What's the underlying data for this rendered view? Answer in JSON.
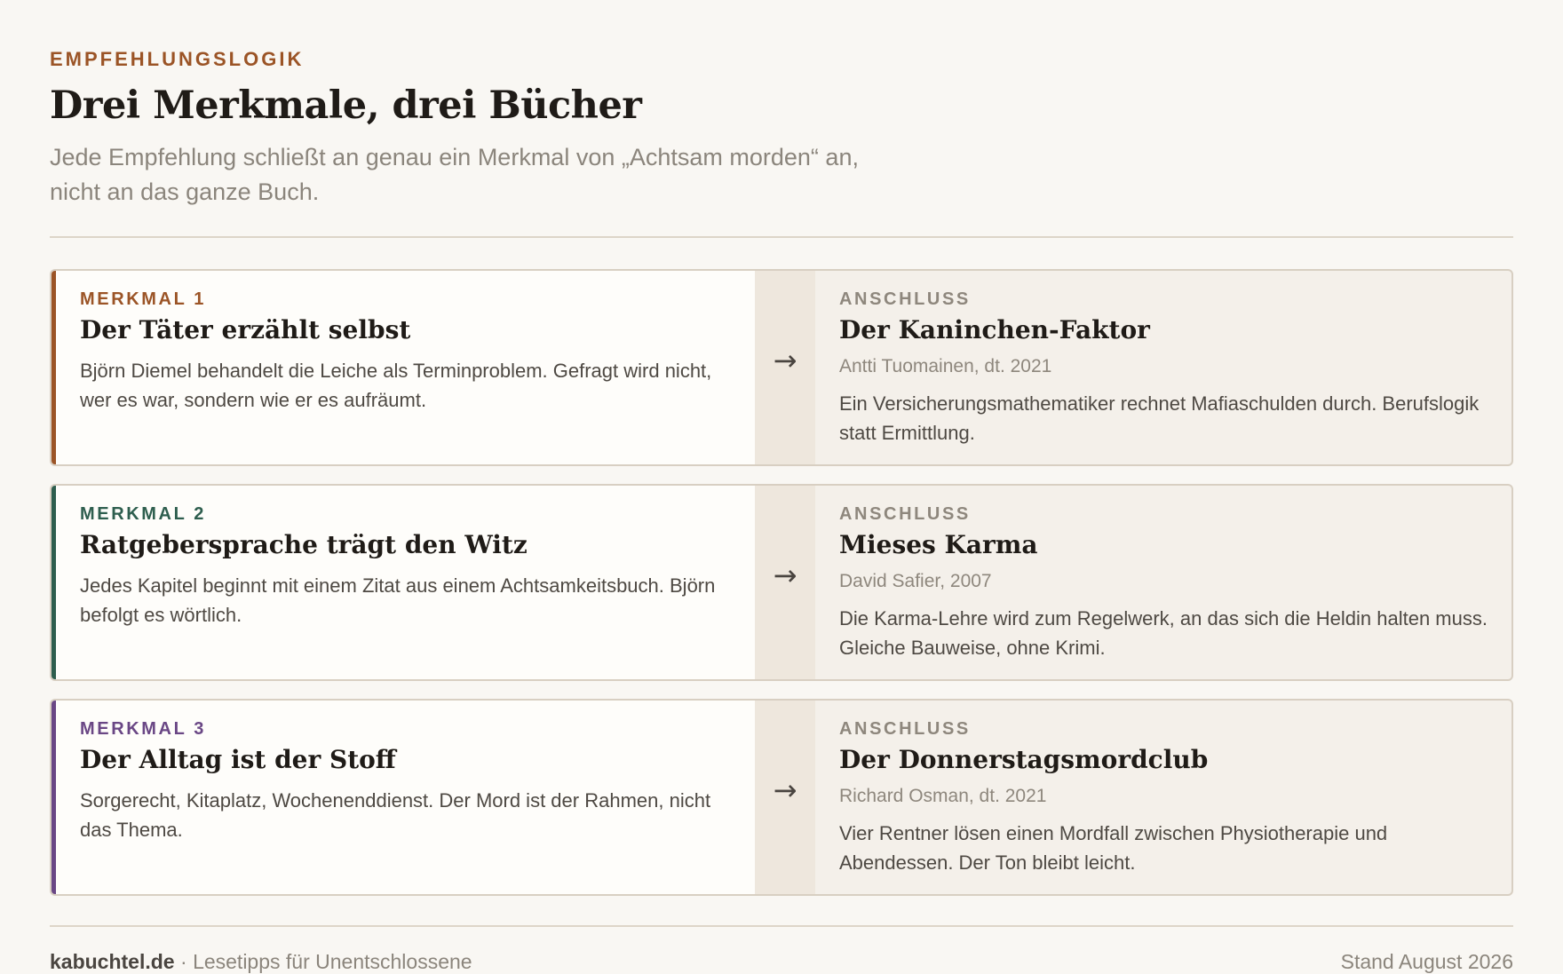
{
  "header": {
    "eyebrow": "EMPFEHLUNGSLOGIK",
    "title": "Drei Merkmale, drei Bücher",
    "subtitle": "Jede Empfehlung schließt an genau ein Merkmal von „Achtsam morden“ an, nicht an das ganze Buch."
  },
  "arrow_glyph": "→",
  "rows": [
    {
      "feature": {
        "label": "MERKMAL 1",
        "color": "#9b5426",
        "title": "Der Täter erzählt selbst",
        "description": "Björn Diemel behandelt die Leiche als Terminproblem. Gefragt wird nicht, wer es war, sondern wie er es aufräumt."
      },
      "match": {
        "label": "ANSCHLUSS",
        "title": "Der Kaninchen-Faktor",
        "meta": "Antti Tuomainen, dt. 2021",
        "description": "Ein Versicherungsmathematiker rechnet Mafiaschulden durch. Berufslogik statt Ermittlung."
      }
    },
    {
      "feature": {
        "label": "MERKMAL 2",
        "color": "#2e5e4e",
        "title": "Ratgebersprache trägt den Witz",
        "description": "Jedes Kapitel beginnt mit einem Zitat aus einem Achtsamkeitsbuch. Björn befolgt es wörtlich."
      },
      "match": {
        "label": "ANSCHLUSS",
        "title": "Mieses Karma",
        "meta": "David Safier, 2007",
        "description": "Die Karma-Lehre wird zum Regelwerk, an das sich die Heldin halten muss. Gleiche Bauweise, ohne Krimi."
      }
    },
    {
      "feature": {
        "label": "MERKMAL 3",
        "color": "#6a4785",
        "title": "Der Alltag ist der Stoff",
        "description": "Sorgerecht, Kitaplatz, Wochenenddienst. Der Mord ist der Rahmen, nicht das Thema."
      },
      "match": {
        "label": "ANSCHLUSS",
        "title": "Der Donnerstagsmordclub",
        "meta": "Richard Osman, dt. 2021",
        "description": "Vier Rentner lösen einen Mordfall zwischen Physiotherapie und Abendessen. Der Ton bleibt leicht."
      }
    }
  ],
  "footer": {
    "site": "kabuchtel.de",
    "separator": " · ",
    "tagline": "Lesetipps für Unentschlossene",
    "status": "Stand August 2026"
  }
}
